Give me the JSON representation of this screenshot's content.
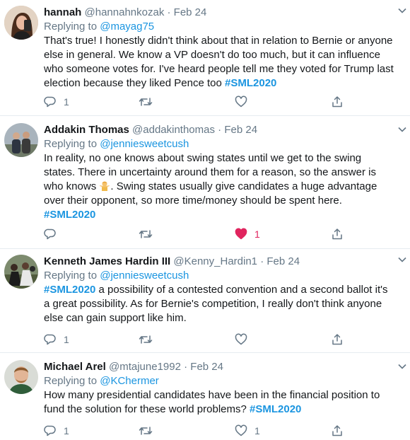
{
  "tweets": [
    {
      "name": "hannah",
      "handle": "@hannahnkozak",
      "dot": "·",
      "date": "Feb 24",
      "replying_prefix": "Replying to ",
      "replying_to": "@mayag75",
      "body_text": "That's true! I honestly didn't think about that in relation to Bernie or anyone else in general. We know a VP doesn't do too much, but it can influence who someone votes for. I've heard people tell me they voted for Trump last election because they liked Pence too ",
      "hashtag": "#SML2020",
      "reply_count": "1",
      "retweet_count": "",
      "like_count": "",
      "liked": false
    },
    {
      "name": "Addakin Thomas",
      "handle": "@addakinthomas",
      "dot": "·",
      "date": "Feb 24",
      "replying_prefix": "Replying to ",
      "replying_to": "@jenniesweetcush",
      "body_text_1": "In reality, no one knows about swing states until we get to the swing states. There in uncertainty around them for a reason, so the answer is who knows ",
      "emoji_name": "person-shrugging-emoji",
      "body_text_2": ". Swing states usually give candidates a huge advantage over their opponent, so more time/money should be spent here.",
      "hashtag": "#SML2020",
      "reply_count": "",
      "retweet_count": "",
      "like_count": "1",
      "liked": true
    },
    {
      "name": "Kenneth James Hardin III",
      "handle": "@Kenny_Hardin1",
      "dot": "·",
      "date": "Feb 24",
      "replying_prefix": "Replying to ",
      "replying_to": "@jenniesweetcush",
      "hashtag": "#SML2020",
      "body_text": " a possibility of a contested convention and a second ballot it's a great possibility. As for Bernie's competition, I really don't think anyone else can gain support like him.",
      "reply_count": "1",
      "retweet_count": "",
      "like_count": "",
      "liked": false
    },
    {
      "name": "Michael Arel",
      "handle": "@mtajune1992",
      "dot": "·",
      "date": "Feb 24",
      "replying_prefix": "Replying to ",
      "replying_to": "@KChermer",
      "body_text": "How many presidential candidates have been in the financial position to fund the solution for these world problems? ",
      "hashtag": "#SML2020",
      "reply_count": "1",
      "retweet_count": "",
      "like_count": "1",
      "liked": false
    }
  ],
  "colors": {
    "link": "#1b95e0",
    "muted": "#657786",
    "like": "#e0245e",
    "divider": "#e6ecf0"
  },
  "icons": {
    "reply": "reply-icon",
    "retweet": "retweet-icon",
    "like": "heart-icon",
    "share": "share-icon",
    "more": "chevron-down-icon"
  }
}
